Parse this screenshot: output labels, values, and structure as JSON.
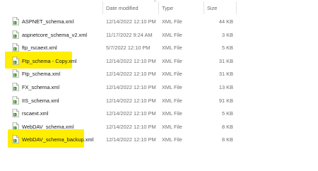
{
  "columns": {
    "date_modified": "Date modified",
    "type": "Type",
    "size": "Size"
  },
  "files": [
    {
      "name": "ASPNET_schema.xml",
      "date": "12/14/2022 12:10 PM",
      "type": "XML File",
      "size": "44 KB",
      "highlighted": false
    },
    {
      "name": "aspnetcore_schema_v2.xml",
      "date": "11/17/2022 9:24 AM",
      "type": "XML File",
      "size": "3 KB",
      "highlighted": false
    },
    {
      "name": "ftp_rscaext.xml",
      "date": "5/7/2022 12:10 PM",
      "type": "XML File",
      "size": "5 KB",
      "highlighted": false
    },
    {
      "name": "Ftp_schema - Copy.xml",
      "date": "12/14/2022 12:10 PM",
      "type": "XML File",
      "size": "31 KB",
      "highlighted": true
    },
    {
      "name": "Ftp_schema.xml",
      "date": "12/14/2022 12:10 PM",
      "type": "XML File",
      "size": "31 KB",
      "highlighted": false
    },
    {
      "name": "FX_schema.xml",
      "date": "12/14/2022 12:10 PM",
      "type": "XML File",
      "size": "13 KB",
      "highlighted": false
    },
    {
      "name": "IIS_schema.xml",
      "date": "12/14/2022 12:10 PM",
      "type": "XML File",
      "size": "91 KB",
      "highlighted": false
    },
    {
      "name": "rscaext.xml",
      "date": "12/14/2022 12:10 PM",
      "type": "XML File",
      "size": "5 KB",
      "highlighted": false
    },
    {
      "name": "WebDAV_schema.xml",
      "date": "12/14/2022 12:10 PM",
      "type": "XML File",
      "size": "8 KB",
      "highlighted": false
    },
    {
      "name": "WebDAV_schema_backup.xml",
      "date": "12/14/2022 12:10 PM",
      "type": "XML File",
      "size": "8 KB",
      "highlighted": true
    }
  ],
  "colors": {
    "highlight": "#ffee00",
    "header_text": "#6b6b6b",
    "secondary_text": "#6f6f6f"
  },
  "icons": {
    "file": "xml-file-icon"
  }
}
